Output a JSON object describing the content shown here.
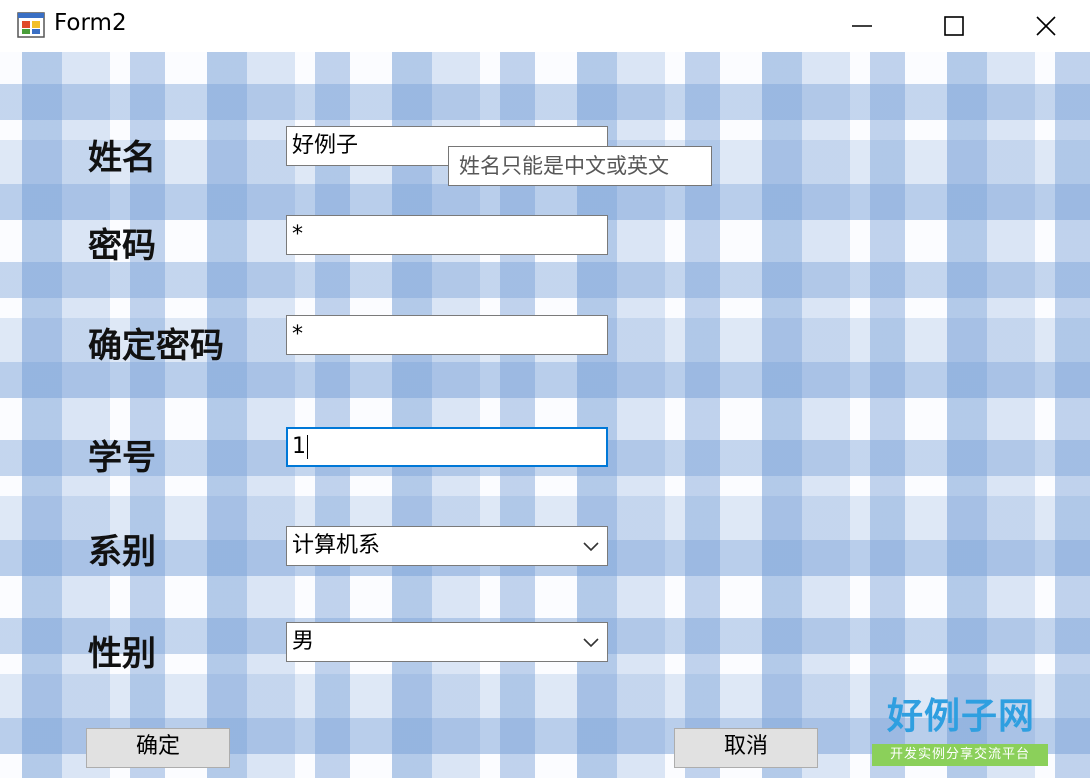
{
  "window": {
    "title": "Form2",
    "icons": {
      "app": "form-app-icon",
      "minimize": "minimize-icon",
      "maximize": "maximize-icon",
      "close": "close-icon"
    }
  },
  "form": {
    "name_label": "姓名",
    "name_value": "好例子",
    "name_tooltip": "姓名只能是中文或英文",
    "password_label": "密码",
    "password_value": "*",
    "confirm_label": "确定密码",
    "confirm_value": "*",
    "student_id_label": "学号",
    "student_id_value": "1",
    "department_label": "系别",
    "department_value": "计算机系",
    "gender_label": "性别",
    "gender_value": "男"
  },
  "buttons": {
    "ok": "确定",
    "cancel": "取消"
  },
  "watermark": {
    "title": "好例子网",
    "subtitle": "开发实例分享交流平台"
  },
  "colors": {
    "focus_border": "#0078d7",
    "plaid": "#78a0d7",
    "watermark_blue": "#2f9fe0",
    "watermark_green": "#8bd05a"
  }
}
